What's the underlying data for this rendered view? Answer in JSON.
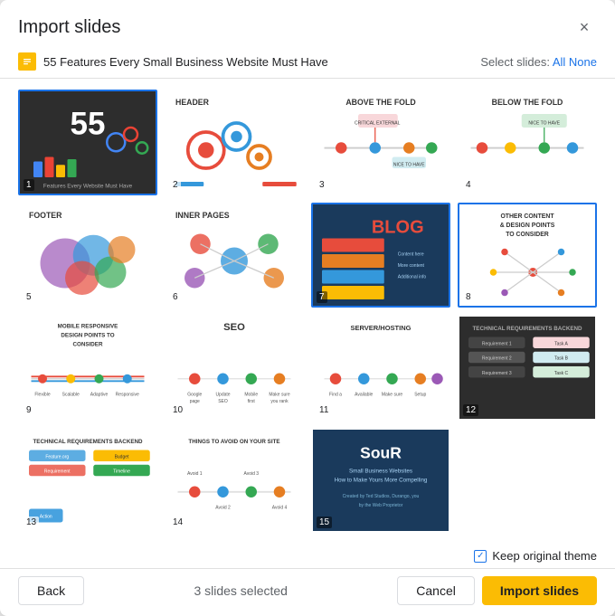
{
  "dialog": {
    "title": "Import slides",
    "close_label": "×"
  },
  "file": {
    "name": "55 Features Every Small Business Website Must Have",
    "icon_color": "#fbbc04"
  },
  "select_slides": {
    "label": "Select slides:",
    "all": "All",
    "none": "None"
  },
  "slides": [
    {
      "id": 1,
      "selected": true,
      "theme": "dark"
    },
    {
      "id": 2,
      "selected": false,
      "theme": "light"
    },
    {
      "id": 3,
      "selected": false,
      "theme": "light"
    },
    {
      "id": 4,
      "selected": false,
      "theme": "light"
    },
    {
      "id": 5,
      "selected": false,
      "theme": "light"
    },
    {
      "id": 6,
      "selected": false,
      "theme": "light"
    },
    {
      "id": 7,
      "selected": true,
      "theme": "dark"
    },
    {
      "id": 8,
      "selected": true,
      "theme": "light"
    },
    {
      "id": 9,
      "selected": false,
      "theme": "light"
    },
    {
      "id": 10,
      "selected": false,
      "theme": "light"
    },
    {
      "id": 11,
      "selected": false,
      "theme": "light"
    },
    {
      "id": 12,
      "selected": false,
      "theme": "dark"
    },
    {
      "id": 13,
      "selected": false,
      "theme": "light"
    },
    {
      "id": 14,
      "selected": false,
      "theme": "light"
    },
    {
      "id": 15,
      "selected": false,
      "theme": "dark"
    }
  ],
  "footer": {
    "back_label": "Back",
    "selected_count": "3 slides selected",
    "cancel_label": "Cancel",
    "import_label": "Import slides"
  },
  "keep_original": {
    "label": "Keep original theme",
    "checked": true
  }
}
